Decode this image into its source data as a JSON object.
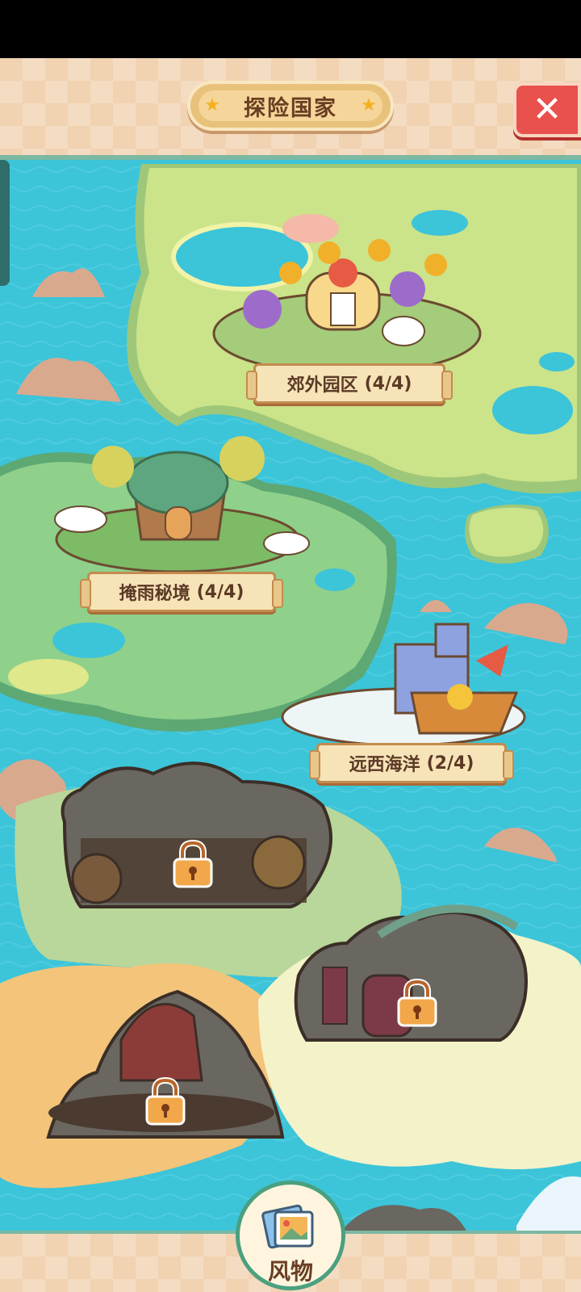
{
  "header": {
    "title": "探险国家",
    "close_icon": "close-x-icon"
  },
  "regions": [
    {
      "name": "郊外园区",
      "progress": "(4/4)",
      "locked": false
    },
    {
      "name": "掩雨秘境",
      "progress": "(4/4)",
      "locked": false
    },
    {
      "name": "远西海洋",
      "progress": "(2/4)",
      "locked": false
    },
    {
      "locked": true,
      "icon": "padlock-icon"
    },
    {
      "locked": true,
      "icon": "padlock-icon"
    },
    {
      "locked": true,
      "icon": "padlock-icon"
    }
  ],
  "footer": {
    "souvenir_label": "风物",
    "souvenir_icon": "photo-album-icon"
  },
  "colors": {
    "sea": "#3cc4d9",
    "land": "#c9df7e",
    "forest": "#8fcf8a",
    "header": "#f1d2b1",
    "accent": "#7cb8a2",
    "close": "#e9514d"
  }
}
